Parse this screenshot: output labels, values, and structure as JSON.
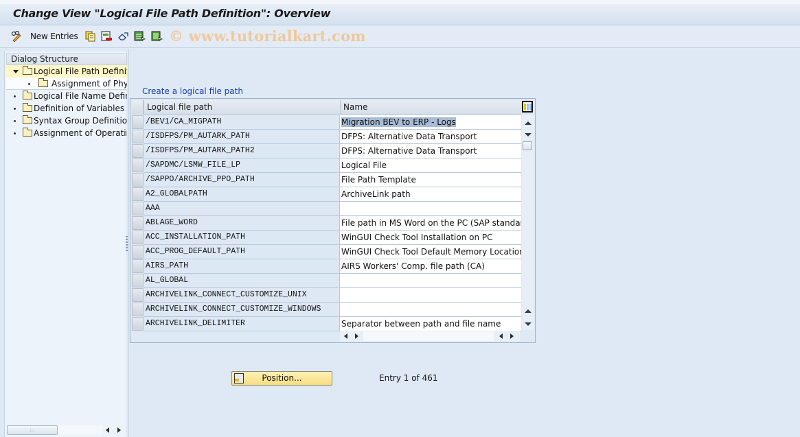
{
  "window": {
    "title": "Change View \"Logical File Path Definition\": Overview"
  },
  "toolbar": {
    "items": [
      {
        "icon": "display-change-icon",
        "label": ""
      },
      {
        "icon": "new-entries",
        "label": "New Entries"
      },
      {
        "icon": "copy-icon",
        "label": ""
      },
      {
        "icon": "delete-icon",
        "label": ""
      },
      {
        "icon": "undo-change-icon",
        "label": ""
      },
      {
        "icon": "select-all-icon",
        "label": ""
      },
      {
        "icon": "select-block-icon",
        "label": ""
      }
    ],
    "watermark": "© www.tutorialkart.com"
  },
  "dialog_structure": {
    "header": "Dialog Structure",
    "items": [
      {
        "label": "Logical File Path Definition",
        "level": 0,
        "expanded": true,
        "selected": true
      },
      {
        "label": "Assignment of Physical Paths",
        "level": 1
      },
      {
        "label": "Logical File Name Definition",
        "level": 0
      },
      {
        "label": "Definition of Variables",
        "level": 0
      },
      {
        "label": "Syntax Group Definition",
        "level": 0
      },
      {
        "label": "Assignment of Operating System",
        "level": 0
      }
    ]
  },
  "main": {
    "table_title": "Create a logical file path",
    "columns": [
      "Logical file path",
      "Name"
    ],
    "rows": [
      {
        "path": "/BEV1/CA_MIGPATH",
        "name": "Migration BEV to ERP - Logs",
        "highlighted": true
      },
      {
        "path": "/ISDFPS/PM_AUTARK_PATH",
        "name": "DFPS: Alternative Data Transport"
      },
      {
        "path": "/ISDFPS/PM_AUTARK_PATH2",
        "name": "DFPS: Alternative Data Transport"
      },
      {
        "path": "/SAPDMC/LSMW_FILE_LP",
        "name": "Logical File"
      },
      {
        "path": "/SAPPO/ARCHIVE_PPO_PATH",
        "name": "File Path Template"
      },
      {
        "path": "A2_GLOBALPATH",
        "name": "ArchiveLink path"
      },
      {
        "path": "AAA",
        "name": ""
      },
      {
        "path": "ABLAGE_WORD",
        "name": "File path in MS Word on the PC (SAP standard in"
      },
      {
        "path": "ACC_INSTALLATION_PATH",
        "name": "WinGUI Check Tool Installation on PC"
      },
      {
        "path": "ACC_PROG_DEFAULT_PATH",
        "name": "WinGUI Check Tool Default Memory Location"
      },
      {
        "path": "AIRS_PATH",
        "name": "AIRS Workers' Comp. file path (CA)"
      },
      {
        "path": "AL_GLOBAL",
        "name": ""
      },
      {
        "path": "ARCHIVELINK_CONNECT_CUSTOMIZE_UNIX",
        "name": ""
      },
      {
        "path": "ARCHIVELINK_CONNECT_CUSTOMIZE_WINDOWS",
        "name": ""
      },
      {
        "path": "ARCHIVELINK_DELIMITER",
        "name": "Separator between path and file name"
      }
    ],
    "position_button": "Position...",
    "entry_info": "Entry 1 of 461"
  },
  "colors": {
    "background": "#dfe9f5",
    "link": "#1a3bb5",
    "selected_tree": "#fdf6c6",
    "button_yellow": "#f7de80",
    "watermark": "#f0c89a"
  }
}
